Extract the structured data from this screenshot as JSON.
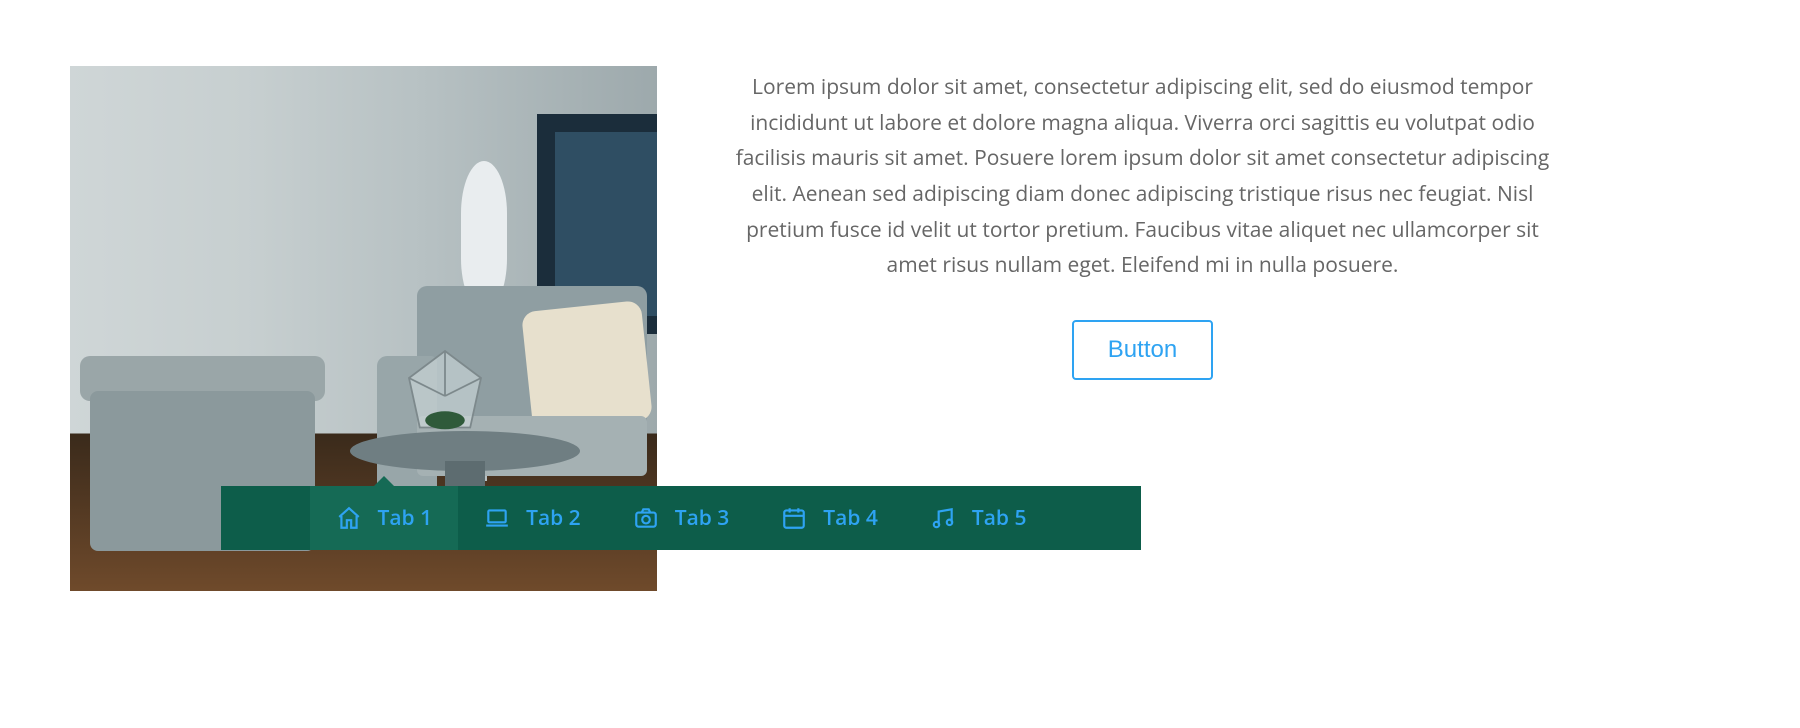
{
  "content": {
    "body_text": "Lorem ipsum dolor sit amet, consectetur adipiscing elit, sed do eiusmod tempor incididunt ut labore et dolore magna aliqua. Viverra orci sagittis eu volutpat odio facilisis mauris sit amet. Posuere lorem ipsum dolor sit amet consectetur adipiscing elit. Aenean sed adipiscing diam donec adipiscing tristique risus nec feugiat. Nisl pretium fusce id velit ut tortor pretium. Faucibus vitae aliquet nec ullamcorper sit amet risus nullam eget. Eleifend mi in nulla posuere.",
    "button_label": "Button"
  },
  "tabs": {
    "items": [
      {
        "label": "Tab 1",
        "icon": "home-icon",
        "active": true
      },
      {
        "label": "Tab 2",
        "icon": "laptop-icon",
        "active": false
      },
      {
        "label": "Tab 3",
        "icon": "camera-icon",
        "active": false
      },
      {
        "label": "Tab 4",
        "icon": "calendar-icon",
        "active": false
      },
      {
        "label": "Tab 5",
        "icon": "music-icon",
        "active": false
      }
    ]
  },
  "colors": {
    "accent": "#2ea3f2",
    "tab_bar_bg": "#0d5d4a",
    "tab_active_bg": "#156a55",
    "text": "#666666"
  }
}
